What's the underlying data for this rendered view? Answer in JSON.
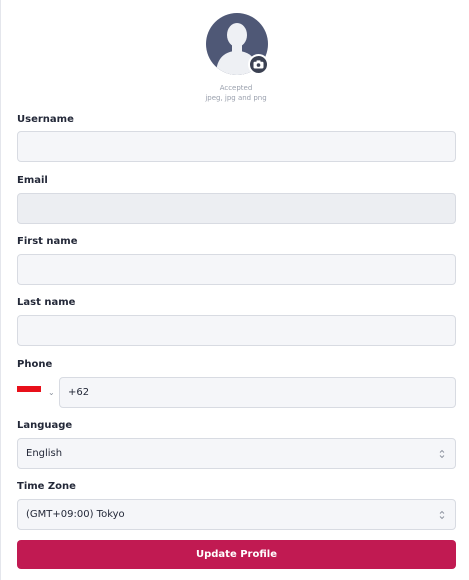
{
  "avatar": {
    "accepted_line1": "Accepted",
    "accepted_line2": "jpeg, jpg and png",
    "icon": "camera-icon"
  },
  "form": {
    "username": {
      "label": "Username",
      "value": ""
    },
    "email": {
      "label": "Email",
      "value": ""
    },
    "first_name": {
      "label": "First name",
      "value": ""
    },
    "last_name": {
      "label": "Last name",
      "value": ""
    },
    "phone": {
      "label": "Phone",
      "value": "+62",
      "country_flag": "indonesia-flag"
    },
    "language": {
      "label": "Language",
      "value": "English"
    },
    "timezone": {
      "label": "Time Zone",
      "value": "(GMT+09:00) Tokyo"
    },
    "submit_label": "Update Profile"
  },
  "colors": {
    "primary": "#c11a52",
    "avatar_bg": "#4f5876",
    "field_bg": "#f5f6f9"
  }
}
